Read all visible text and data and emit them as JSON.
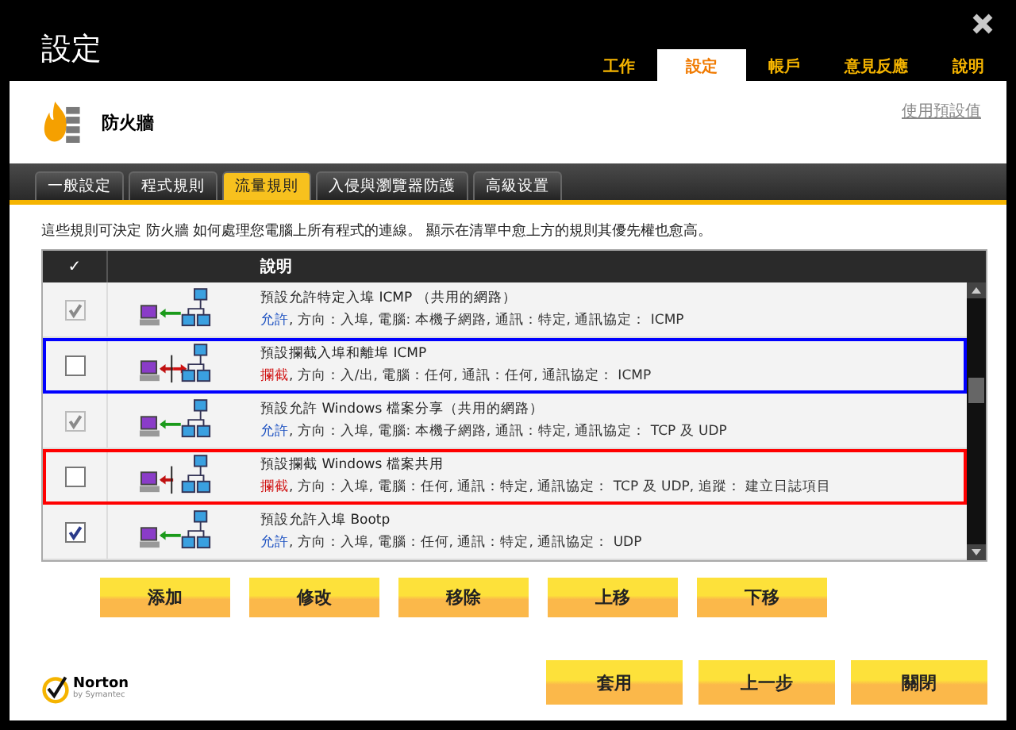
{
  "window": {
    "title": "設定"
  },
  "nav": [
    {
      "label": "工作",
      "selected": false
    },
    {
      "label": "設定",
      "selected": true
    },
    {
      "label": "帳戶",
      "selected": false
    },
    {
      "label": "意見反應",
      "selected": false
    },
    {
      "label": "說明",
      "selected": false
    }
  ],
  "section": {
    "title": "防火牆",
    "link": "使用預設值"
  },
  "tabs": [
    {
      "label": "一般設定",
      "selected": false
    },
    {
      "label": "程式規則",
      "selected": false
    },
    {
      "label": "流量規則",
      "selected": true
    },
    {
      "label": "入侵與瀏覽器防護",
      "selected": false
    },
    {
      "label": "高級设置",
      "selected": false
    }
  ],
  "intro": "這些規則可決定 防火牆 如何處理您電腦上所有程式的連線。 顯示在清單中愈上方的規則其優先權也愈高。",
  "table": {
    "columns": [
      "✓",
      "說明"
    ],
    "rows": [
      {
        "checked": true,
        "disabled": true,
        "kind": "allow",
        "bidirectional": false,
        "title": "預設允許特定入埠 ICMP （共用的網路）",
        "action": "允許",
        "details": ", 方向：入埠, 電腦: 本機子網路, 通訊：特定, 通訊協定： ICMP"
      },
      {
        "checked": false,
        "disabled": false,
        "kind": "block",
        "bidirectional": true,
        "color": "#0000ff",
        "title": "預設攔截入埠和離埠 ICMP",
        "action": "攔截",
        "details": ", 方向：入/出, 電腦：任何, 通訊：任何, 通訊協定： ICMP"
      },
      {
        "checked": true,
        "disabled": true,
        "kind": "allow",
        "bidirectional": false,
        "title": "預設允許 Windows 檔案分享（共用的網路）",
        "action": "允許",
        "details": ", 方向：入埠, 電腦: 本機子網路, 通訊：特定, 通訊協定： TCP 及 UDP"
      },
      {
        "checked": false,
        "disabled": false,
        "kind": "block",
        "bidirectional": false,
        "color": "#ff0000",
        "title": "預設攔截 Windows 檔案共用",
        "action": "攔截",
        "details": ", 方向：入埠, 電腦：任何, 通訊：特定, 通訊協定： TCP 及 UDP, 追蹤： 建立日誌項目"
      },
      {
        "checked": true,
        "disabled": false,
        "kind": "allow",
        "bidirectional": false,
        "title": "預設允許入埠 Bootp",
        "action": "允許",
        "details": ", 方向：入埠, 電腦：任何, 通訊：特定, 通訊協定： UDP"
      }
    ]
  },
  "list_buttons": [
    "添加",
    "修改",
    "移除",
    "上移",
    "下移"
  ],
  "logo": {
    "name": "Norton",
    "tagline": "by Symantec"
  },
  "footer_buttons": [
    "套用",
    "上一步",
    "關閉"
  ]
}
